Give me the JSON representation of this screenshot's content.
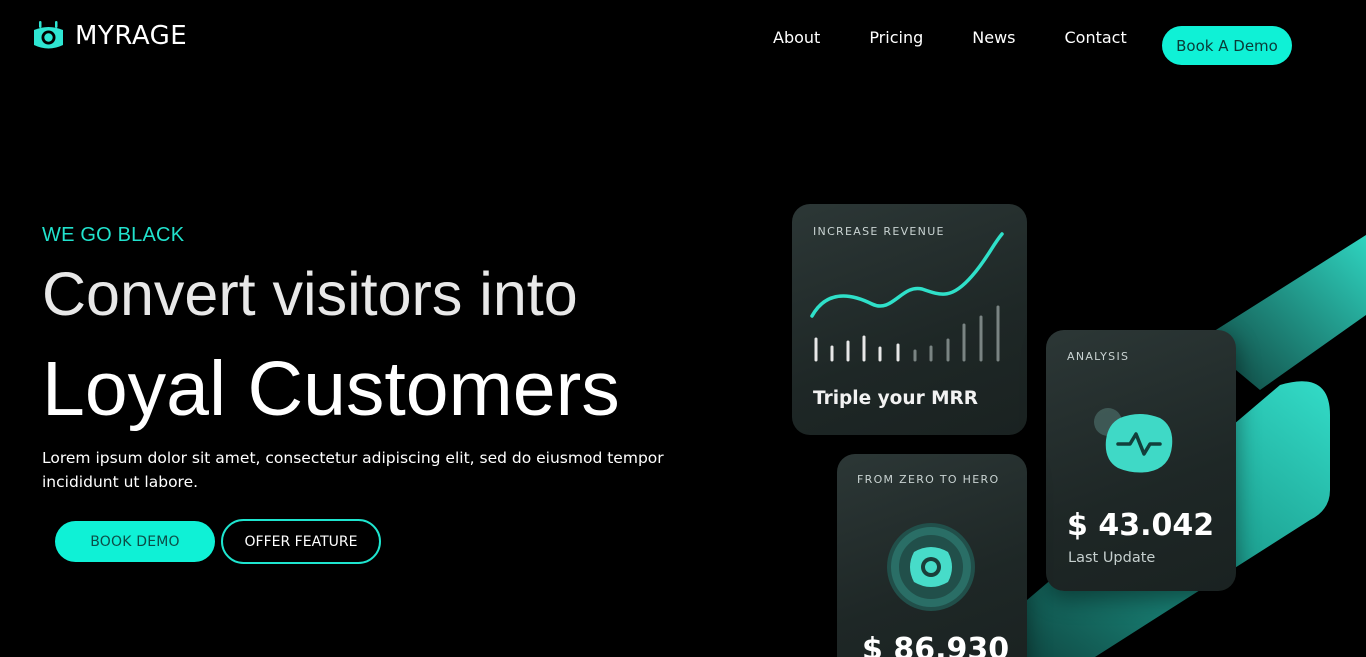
{
  "brand": {
    "name": "MYRAGE",
    "logo_icon": "eye-monitor-icon",
    "accent": "#0ff1d6"
  },
  "nav": {
    "items": [
      {
        "label": "About"
      },
      {
        "label": "Pricing"
      },
      {
        "label": "News"
      },
      {
        "label": "Contact"
      }
    ],
    "cta_label": "Book A Demo"
  },
  "hero": {
    "eyebrow": "WE GO BLACK",
    "headline_line1": "Convert visitors into",
    "headline_line2": "Loyal Customers",
    "lead": "Lorem ipsum dolor sit amet, consectetur adipiscing elit, sed do eiusmod tempor incididunt ut labore.",
    "primary_button": "BOOK DEMO",
    "secondary_button": "OFFER FEATURE"
  },
  "cards": {
    "revenue": {
      "label": "INCREASE REVENUE",
      "caption": "Triple your MRR",
      "icon": "trend-line-icon"
    },
    "analysis": {
      "label": "ANALYSIS",
      "amount": "$ 43.042",
      "subtitle": "Last Update",
      "icon": "pulse-icon"
    },
    "hero": {
      "label": "FROM ZERO TO HERO",
      "amount": "$ 86.930",
      "icon": "target-ring-icon"
    }
  }
}
